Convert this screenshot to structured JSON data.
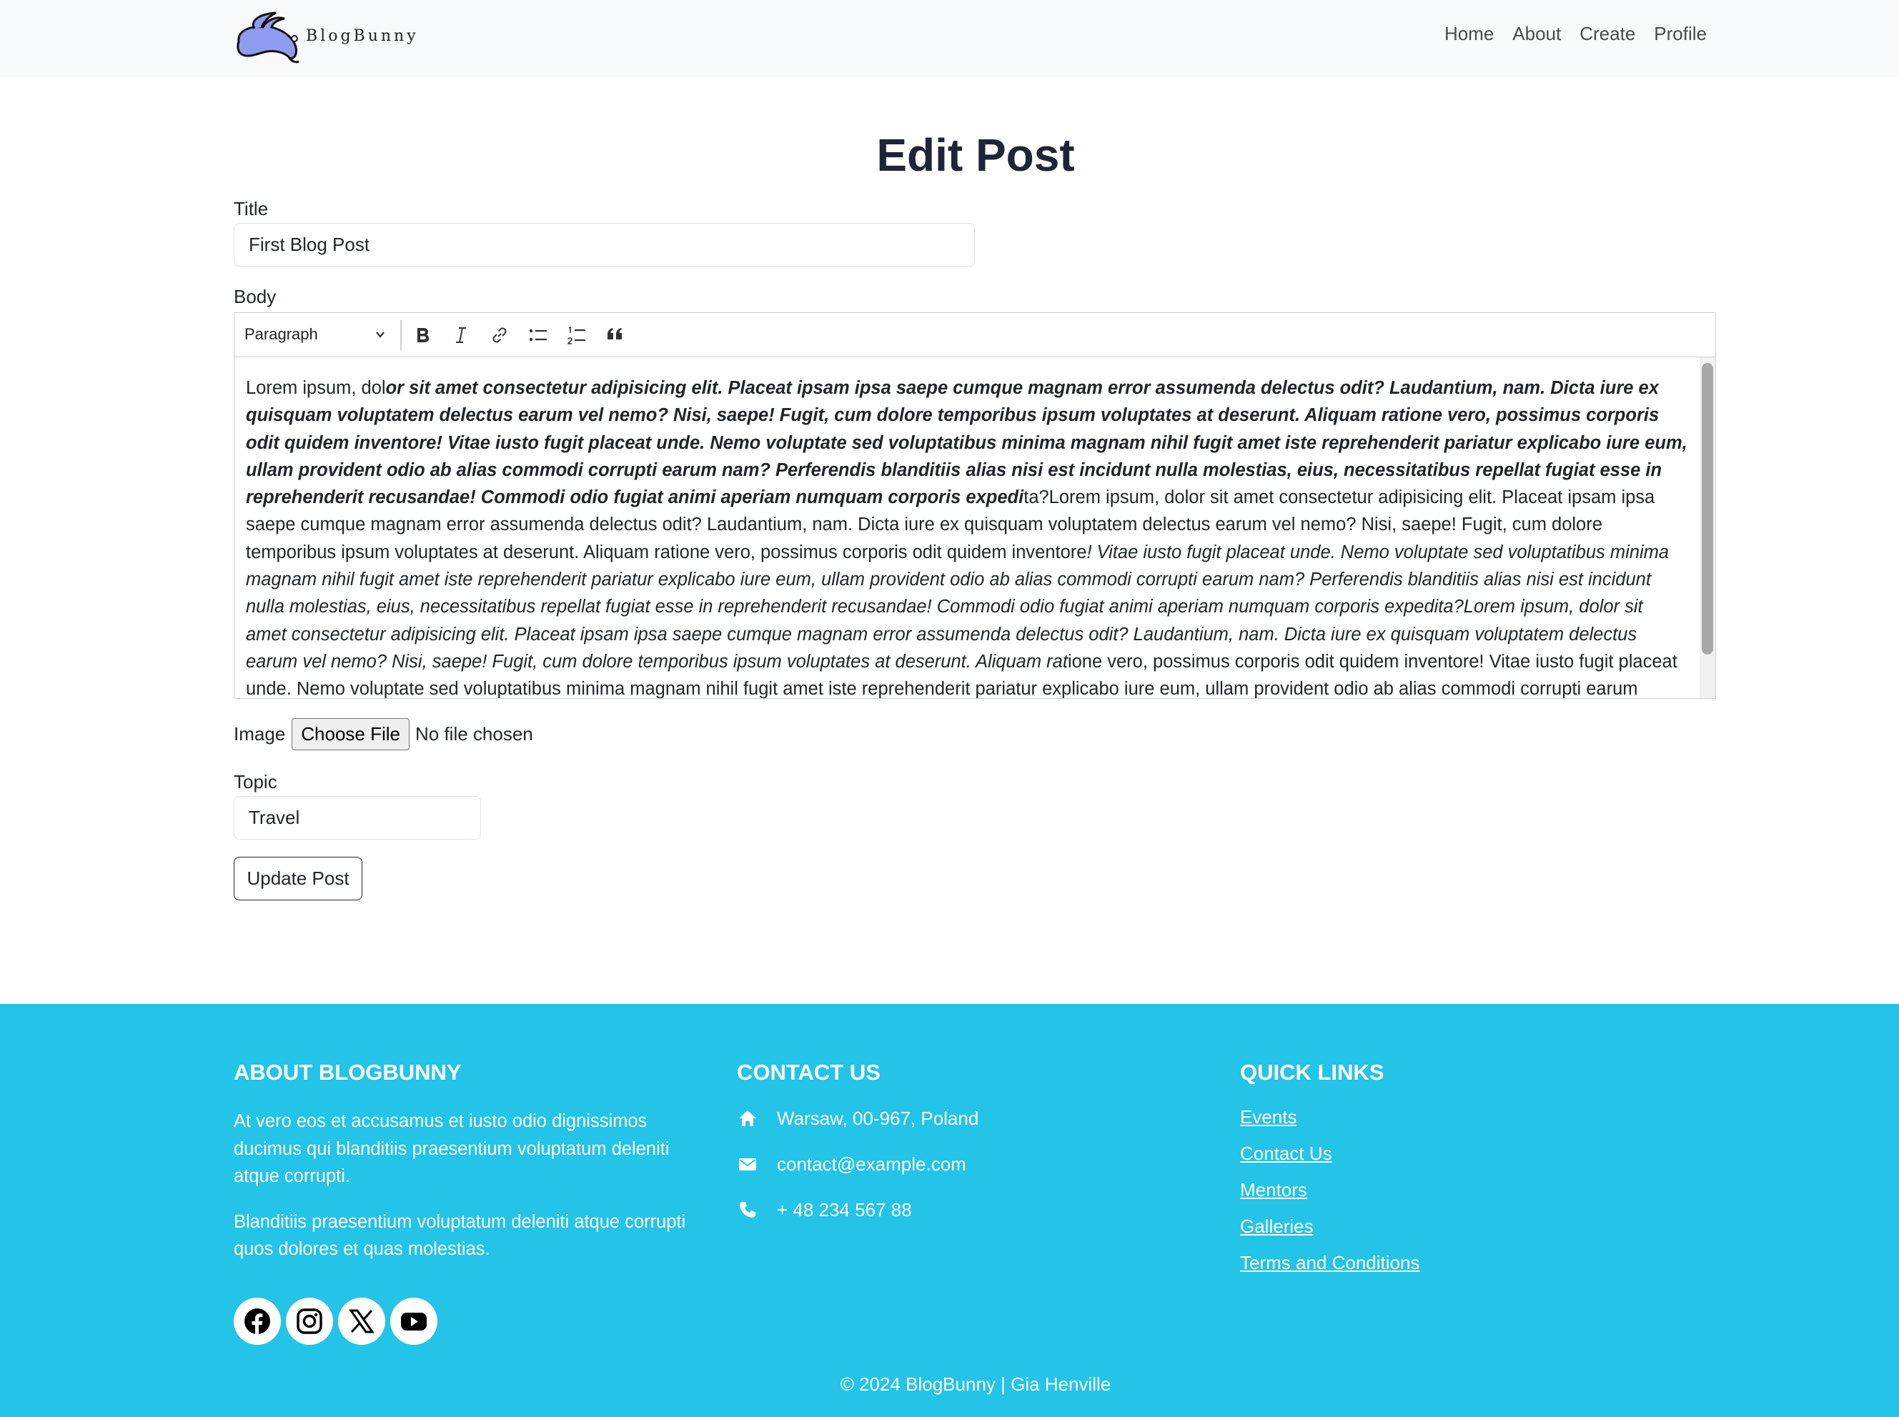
{
  "navbar": {
    "brand": "BlogBunny",
    "links": [
      "Home",
      "About",
      "Create",
      "Profile"
    ]
  },
  "page": {
    "title": "Edit Post"
  },
  "form": {
    "title_label": "Title",
    "title_value": "First Blog Post",
    "body_label": "Body",
    "toolbar": {
      "heading_select": "Paragraph",
      "buttons": [
        "bold-icon",
        "italic-icon",
        "link-icon",
        "bulleted-list-icon",
        "numbered-list-icon",
        "blockquote-icon"
      ]
    },
    "body_segments": [
      {
        "style": "normal",
        "text": "Lorem ipsum, dol"
      },
      {
        "style": "bold-italic",
        "text": "or sit amet consectetur adipisicing elit. Placeat ipsam ipsa saepe cumque magnam error assumenda delectus odit? Laudantium, nam. Dicta iure ex quisquam voluptatem delectus earum vel nemo? Nisi, saepe! Fugit, cum dolore temporibus ipsum voluptates at deserunt. Aliquam ratione vero, possimus corporis odit quidem inventore! Vitae iusto fugit placeat unde. Nemo voluptate sed voluptatibus minima magnam nihil fugit amet iste reprehenderit pariatur explicabo iure eum, ullam provident odio ab alias commodi corrupti earum nam? Perferendis blanditiis alias nisi est incidunt nulla molestias, eius, necessitatibus repellat fugiat esse in reprehenderit recusandae! Commodi odio fugiat animi aperiam numquam corporis expedi"
      },
      {
        "style": "normal",
        "text": "ta?Lorem ipsum, dolor sit amet consectetur adipisicing elit. Placeat ipsam ipsa saepe cumque magnam error assumenda delectus odit? Laudantium, nam. Dicta iure ex quisquam voluptatem delectus earum vel nemo? Nisi, saepe! Fugit, cum dolore temporibus ipsum voluptates at deserunt. Aliquam ratione vero, possimus corporis odit quidem inventore"
      },
      {
        "style": "italic",
        "text": "! Vitae iusto fugit placeat unde. Nemo voluptate sed voluptatibus minima magnam nihil fugit amet iste reprehenderit pariatur explicabo iure eum, ullam provident odio ab alias commodi corrupti earum nam? Perferendis blanditiis alias nisi est incidunt nulla molestias, eius, necessitatibus repellat fugiat esse in reprehenderit recusandae! Commodi odio fugiat animi aperiam numquam corporis expedita?Lorem ipsum, dolor sit amet consectetur adipisicing elit. Placeat ipsam ipsa saepe cumque magnam error assumenda delectus odit? Laudantium, nam. Dicta iure ex quisquam voluptatem delectus earum vel nemo? Nisi, saepe! Fugit, cum dolore temporibus ipsum voluptates at deserunt. Aliquam rat"
      },
      {
        "style": "normal",
        "text": "ione vero, possimus corporis odit quidem inventore! Vitae iusto fugit placeat unde. Nemo voluptate sed voluptatibus minima magnam nihil fugit amet iste reprehenderit pariatur explicabo iure eum, ullam provident odio ab alias commodi corrupti earum nam? Perferendis blanditiis alias nisi est incidunt nulla molestias,"
      }
    ],
    "image_label": "Image",
    "file_button": "Choose File",
    "file_status": "No file chosen",
    "topic_label": "Topic",
    "topic_value": "Travel",
    "submit": "Update Post"
  },
  "footer": {
    "about": {
      "heading": "ABOUT BLOGBUNNY",
      "p1": "At vero eos et accusamus et iusto odio dignissimos ducimus qui blanditiis praesentium voluptatum deleniti atque corrupti.",
      "p2": "Blanditiis praesentium voluptatum deleniti atque corrupti quos dolores et quas molestias."
    },
    "contact": {
      "heading": "CONTACT US",
      "address": "Warsaw, 00-967, Poland",
      "email": "contact@example.com",
      "phone": "+ 48 234 567 88"
    },
    "quick_links": {
      "heading": "QUICK LINKS",
      "links": [
        "Events",
        "Contact Us",
        "Mentors",
        "Galleries",
        "Terms and Conditions"
      ]
    },
    "socials": [
      "facebook-icon",
      "instagram-icon",
      "x-icon",
      "youtube-icon"
    ],
    "copyright": "© 2024 BlogBunny | Gia Henville"
  },
  "colors": {
    "navbar_bg": "#f8f9fa",
    "footer_bg": "#24c3e8",
    "title_color": "#1f2437",
    "logo_fill": "#8f9bf0"
  }
}
